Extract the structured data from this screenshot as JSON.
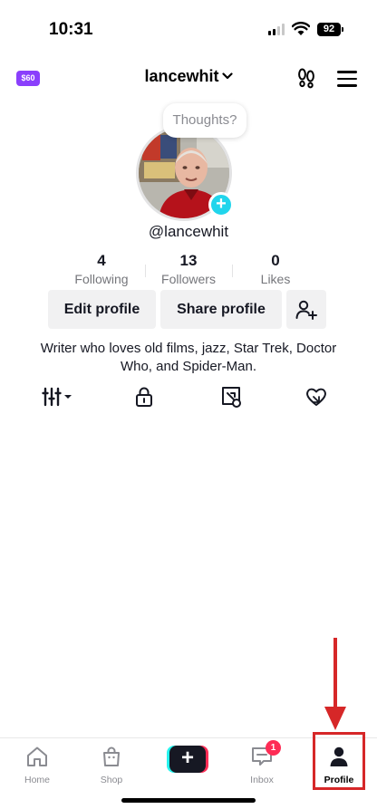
{
  "status_bar": {
    "time": "10:31",
    "battery": "92"
  },
  "header": {
    "coin_label": "$60",
    "username": "lancewhit"
  },
  "profile": {
    "thought_bubble": "Thoughts?",
    "handle": "@lancewhit",
    "stats": [
      {
        "value": "4",
        "label": "Following"
      },
      {
        "value": "13",
        "label": "Followers"
      },
      {
        "value": "0",
        "label": "Likes"
      }
    ],
    "edit_label": "Edit profile",
    "share_label": "Share profile",
    "bio": "Writer who loves old films, jazz, Star Trek, Doctor Who, and Spider-Man."
  },
  "content_tabs": [
    "grid-filter-icon",
    "lock-icon",
    "tagged-icon",
    "liked-icon"
  ],
  "nav": {
    "home": "Home",
    "shop": "Shop",
    "create": "+",
    "inbox": "Inbox",
    "inbox_badge": "1",
    "profile": "Profile"
  },
  "colors": {
    "accent_cyan": "#20d5ec",
    "accent_pink": "#fe2c55",
    "coin_purple": "#8a3ffc",
    "annotation_red": "#d62728"
  }
}
